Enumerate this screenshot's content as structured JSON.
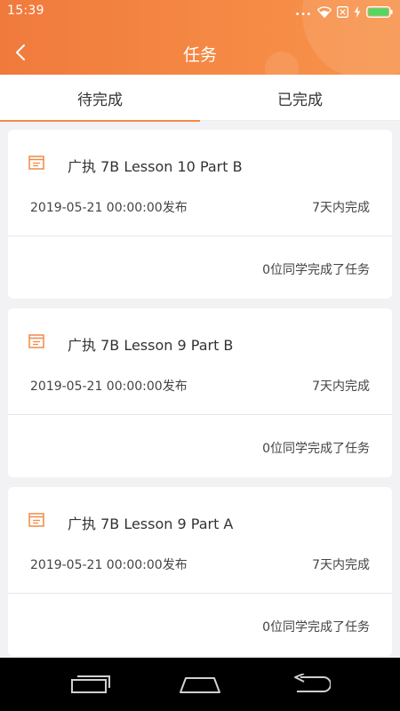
{
  "status_bar": {
    "time": "15:39",
    "more_indicator": "...",
    "icons": [
      "wifi-icon",
      "sim-card-icon",
      "charging-icon",
      "battery-icon"
    ],
    "battery_color": "#4cd964"
  },
  "header": {
    "title": "任务",
    "background_color": "#f58a45",
    "back_icon": "chevron-left-icon"
  },
  "tabs": [
    {
      "label": "待完成",
      "active": true
    },
    {
      "label": "已完成",
      "active": false
    }
  ],
  "accent_color": "#f08a46",
  "tasks": [
    {
      "icon": "task-document-icon",
      "title": "广执 7B Lesson 10 Part B",
      "published": "2019-05-21 00:00:00发布",
      "deadline": "7天内完成",
      "progress": "0位同学完成了任务"
    },
    {
      "icon": "task-document-icon",
      "title": "广执 7B Lesson 9 Part B",
      "published": "2019-05-21 00:00:00发布",
      "deadline": "7天内完成",
      "progress": "0位同学完成了任务"
    },
    {
      "icon": "task-document-icon",
      "title": "广执 7B Lesson 9 Part A",
      "published": "2019-05-21 00:00:00发布",
      "deadline": "7天内完成",
      "progress": "0位同学完成了任务"
    }
  ],
  "system_nav": {
    "buttons": [
      "recent-apps-icon",
      "home-icon",
      "back-icon"
    ]
  }
}
